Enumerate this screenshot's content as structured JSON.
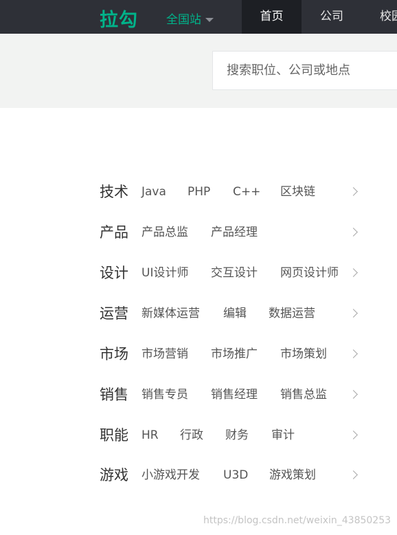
{
  "header": {
    "logo": "拉勾",
    "site_select": "全国站",
    "nav": [
      "首页",
      "公司",
      "校园"
    ]
  },
  "search": {
    "placeholder": "搜索职位、公司或地点"
  },
  "menu": [
    {
      "category": "技术",
      "links": [
        "Java",
        "PHP",
        "C++",
        "区块链"
      ]
    },
    {
      "category": "产品",
      "links": [
        "产品总监",
        "产品经理"
      ]
    },
    {
      "category": "设计",
      "links": [
        "UI设计师",
        "交互设计",
        "网页设计师"
      ]
    },
    {
      "category": "运营",
      "links": [
        "新媒体运营",
        "编辑",
        "数据运营"
      ]
    },
    {
      "category": "市场",
      "links": [
        "市场营销",
        "市场推广",
        "市场策划"
      ]
    },
    {
      "category": "销售",
      "links": [
        "销售专员",
        "销售经理",
        "销售总监"
      ]
    },
    {
      "category": "职能",
      "links": [
        "HR",
        "行政",
        "财务",
        "审计"
      ]
    },
    {
      "category": "游戏",
      "links": [
        "小游戏开发",
        "U3D",
        "游戏策划"
      ]
    }
  ],
  "watermark": "https://blog.csdn.net/weixin_43850253"
}
